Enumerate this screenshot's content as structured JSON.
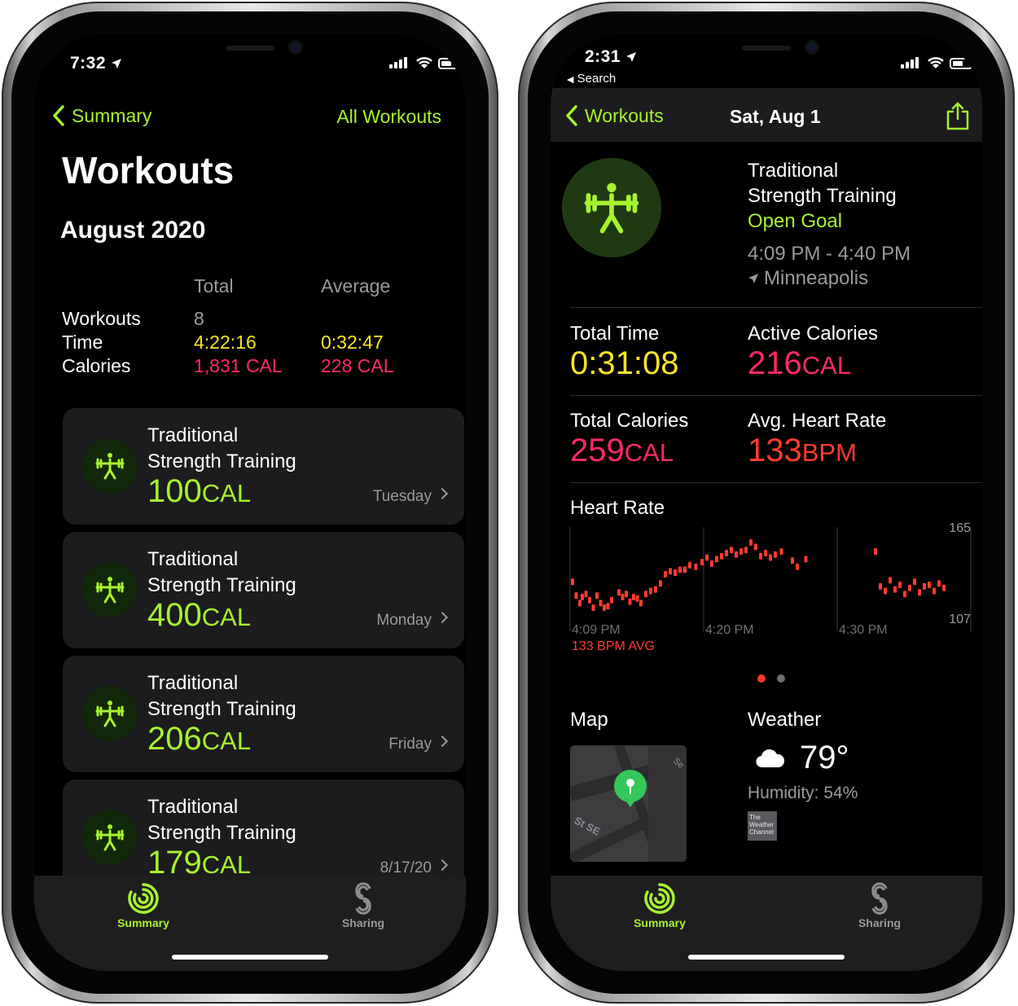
{
  "left": {
    "status": {
      "time": "7:32"
    },
    "nav": {
      "back_label": "Summary",
      "right_label": "All Workouts"
    },
    "title": "Workouts",
    "month": "August 2020",
    "stats": {
      "headers": [
        "Total",
        "Average"
      ],
      "workouts_label": "Workouts",
      "workouts_total": "8",
      "time_label": "Time",
      "time_total": "4:22:16",
      "time_avg": "0:32:47",
      "calories_label": "Calories",
      "calories_total": "1,831 CAL",
      "calories_avg": "228 CAL"
    },
    "workouts": [
      {
        "line1": "Traditional",
        "line2": "Strength Training",
        "cal_value": "100",
        "cal_unit": "CAL",
        "day": "Tuesday"
      },
      {
        "line1": "Traditional",
        "line2": "Strength Training",
        "cal_value": "400",
        "cal_unit": "CAL",
        "day": "Monday"
      },
      {
        "line1": "Traditional",
        "line2": "Strength Training",
        "cal_value": "206",
        "cal_unit": "CAL",
        "day": "Friday"
      },
      {
        "line1": "Traditional",
        "line2": "Strength Training",
        "cal_value": "179",
        "cal_unit": "CAL",
        "day": "8/17/20"
      }
    ],
    "tabs": {
      "summary": "Summary",
      "sharing": "Sharing"
    }
  },
  "right": {
    "status": {
      "time": "2:31",
      "back_app": "Search"
    },
    "nav": {
      "back_label": "Workouts",
      "title": "Sat, Aug 1"
    },
    "workout": {
      "line1": "Traditional",
      "line2": "Strength Training",
      "goal": "Open Goal",
      "time_range": "4:09 PM - 4:40 PM",
      "location": "Minneapolis"
    },
    "metrics": {
      "total_time_label": "Total Time",
      "total_time": "0:31:08",
      "active_cal_label": "Active Calories",
      "active_cal_value": "216",
      "active_cal_unit": "CAL",
      "total_cal_label": "Total Calories",
      "total_cal_value": "259",
      "total_cal_unit": "CAL",
      "hr_label": "Avg. Heart Rate",
      "hr_value": "133",
      "hr_unit": "BPM"
    },
    "heart_rate": {
      "title": "Heart Rate",
      "avg_label": "133 BPM AVG",
      "max_label": "165",
      "min_label": "107",
      "x_labels": [
        "4:09 PM",
        "4:20 PM",
        "4:30 PM"
      ]
    },
    "map": {
      "label": "Map",
      "street": "St SE",
      "street2": "Se"
    },
    "weather": {
      "label": "Weather",
      "temp": "79°",
      "humidity": "Humidity: 54%",
      "logo_lines": [
        "The",
        "Weather",
        "Channel"
      ]
    },
    "tabs": {
      "summary": "Summary",
      "sharing": "Sharing"
    }
  },
  "chart_data": {
    "type": "scatter",
    "title": "Heart Rate",
    "xlabel": "",
    "ylabel": "",
    "ylim": [
      107,
      165
    ],
    "x_ticks": [
      "4:09 PM",
      "4:20 PM",
      "4:30 PM"
    ],
    "series": [
      {
        "x": [
          0.2,
          0.5,
          0.8,
          1.0,
          1.3,
          1.6,
          1.9,
          2.2,
          2.5,
          2.8,
          3.1,
          3.4,
          4.0,
          4.3,
          4.6,
          4.9,
          5.2,
          5.5,
          5.8,
          6.2,
          6.6,
          7.0,
          7.4,
          7.8,
          8.2,
          8.6,
          9.0,
          9.4,
          9.8,
          10.3,
          10.8,
          11.2,
          11.6,
          12.0,
          12.4,
          12.8,
          13.2,
          13.6,
          14.0,
          14.4,
          14.8,
          15.2,
          15.6,
          16.0,
          16.4,
          16.8,
          17.3,
          18.2,
          18.6,
          19.3,
          25.0,
          25.4,
          25.8,
          26.2,
          26.6,
          27.0,
          27.4,
          27.8,
          28.2,
          28.6,
          29.0,
          29.4,
          29.8,
          30.2,
          30.6
        ],
        "y": [
          131,
          122,
          117,
          121,
          123,
          119,
          114,
          122,
          117,
          114,
          115,
          119,
          124,
          121,
          123,
          118,
          121,
          120,
          117,
          123,
          125,
          126,
          130,
          136,
          138,
          137,
          139,
          139,
          142,
          141,
          144,
          147,
          143,
          146,
          148,
          150,
          152,
          149,
          151,
          152,
          157,
          154,
          148,
          150,
          147,
          149,
          151,
          145,
          141,
          146,
          151,
          128,
          125,
          132,
          126,
          129,
          123,
          127,
          131,
          124,
          128,
          129,
          125,
          130,
          127
        ]
      }
    ]
  }
}
